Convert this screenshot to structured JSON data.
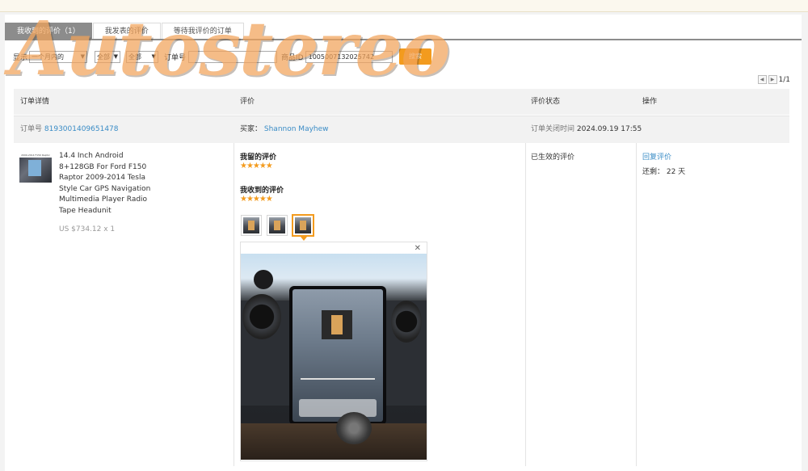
{
  "tabs": [
    {
      "label": "我收到的评价（1）",
      "active": true
    },
    {
      "label": "我发表的评价",
      "active": false
    },
    {
      "label": "等待我评价的订单",
      "active": false
    }
  ],
  "filter": {
    "show_label": "显示",
    "period_value": "一个月内的",
    "select2_value": "全部",
    "select3_value": "全部",
    "order_label": "订单号",
    "order_value": "",
    "product_label": "商品ID",
    "product_value": "1005007132025742",
    "search_label": "搜索"
  },
  "pager": {
    "text": "1/1"
  },
  "table_headers": [
    "订单详情",
    "评价",
    "评价状态",
    "操作"
  ],
  "order": {
    "id_label": "订单号",
    "id_value": "8193001409651478",
    "buyer_label": "买家：",
    "buyer_name": "Shannon Mayhew",
    "closed_label": "订单关闭时间",
    "closed_time": "2024.09.19 17:55"
  },
  "product": {
    "thumb_caption": "2009-2014 F150 Raptor",
    "name": "14.4 Inch Android 8+128GB For Ford F150 Raptor 2009-2014 Tesla Style Car GPS Navigation Multimedia Player Radio Tape Headunit",
    "price": "US $734.12 x 1"
  },
  "reviews": {
    "left_label": "我留的评价",
    "left_stars": "★★★★★",
    "received_label": "我收到的评价",
    "received_stars": "★★★★★"
  },
  "preview": {
    "close_glyph": "✕"
  },
  "status_text": "已生效的评价",
  "actions": {
    "reply_label": "回复评价",
    "remaining": "还剩： 22 天"
  },
  "watermark": "Autostereo",
  "colors": {
    "accent": "#f39b1e",
    "link": "#3a8cc6",
    "tab_active": "#8c8c8c"
  }
}
